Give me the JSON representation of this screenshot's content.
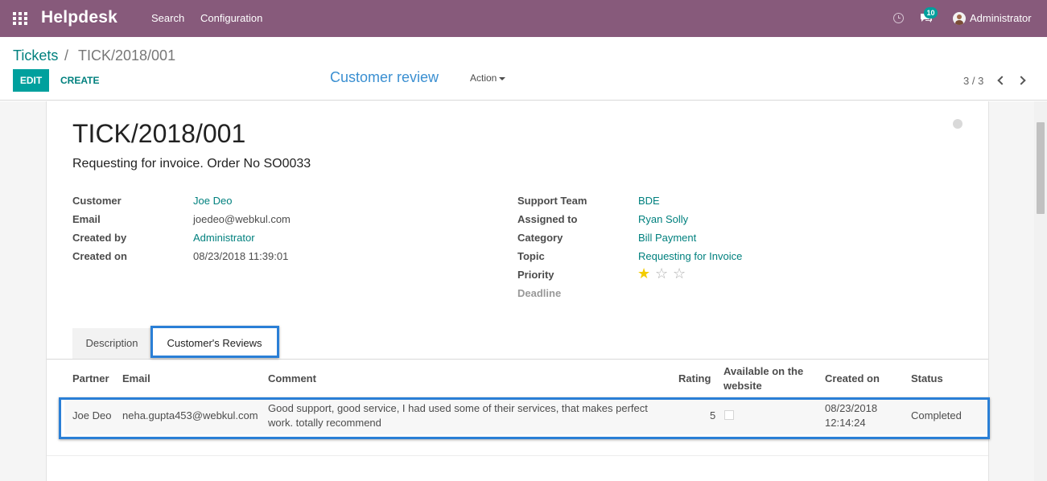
{
  "topbar": {
    "brand": "Helpdesk",
    "menu": [
      "Search",
      "Configuration"
    ],
    "chat_count": "10",
    "user": "Administrator"
  },
  "breadcrumb": {
    "parent": "Tickets",
    "separator": "/",
    "current": "TICK/2018/001"
  },
  "buttons": {
    "edit": "EDIT",
    "create": "CREATE",
    "smart": "Customer review",
    "action": "Action"
  },
  "pager": {
    "value": "3 / 3"
  },
  "ticket": {
    "number": "TICK/2018/001",
    "subject": "Requesting for invoice. Order No SO0033"
  },
  "left_fields": [
    {
      "label": "Customer",
      "value": "Joe Deo"
    },
    {
      "label": "Email",
      "value": "joedeo@webkul.com"
    },
    {
      "label": "Created by",
      "value": "Administrator"
    },
    {
      "label": "Created on",
      "value": "08/23/2018 11:39:01"
    }
  ],
  "right_fields": [
    {
      "label": "Support Team",
      "value": "BDE"
    },
    {
      "label": "Assigned to",
      "value": "Ryan Solly"
    },
    {
      "label": "Category",
      "value": "Bill Payment"
    },
    {
      "label": "Topic",
      "value": "Requesting for Invoice"
    },
    {
      "label": "Priority",
      "value": ""
    },
    {
      "label": "Deadline",
      "value": ""
    }
  ],
  "priority": {
    "stars": [
      "★",
      "☆",
      "☆"
    ],
    "level": 1,
    "max": 3
  },
  "tabs": [
    "Description",
    "Customer's Reviews"
  ],
  "reviews": {
    "headers": [
      "Partner",
      "Email",
      "Comment",
      "Rating",
      "Available on the",
      "website",
      "Created on",
      "Status"
    ],
    "row": {
      "partner": "Joe Deo",
      "email": "neha.gupta453@webkul.com",
      "comment_line1": "Good support, good service, I had used some of their services, that makes perfect",
      "comment_line2": "work. totally recommend",
      "rating": "5",
      "website": false,
      "created_date": "08/23/2018",
      "created_time": "12:14:24",
      "status": "Completed"
    }
  },
  "colors": {
    "topbar": "#875a7b",
    "primary": "#00a09d",
    "link": "#00807e",
    "highlight": "#2a7fd6",
    "star": "#f3cc00"
  }
}
